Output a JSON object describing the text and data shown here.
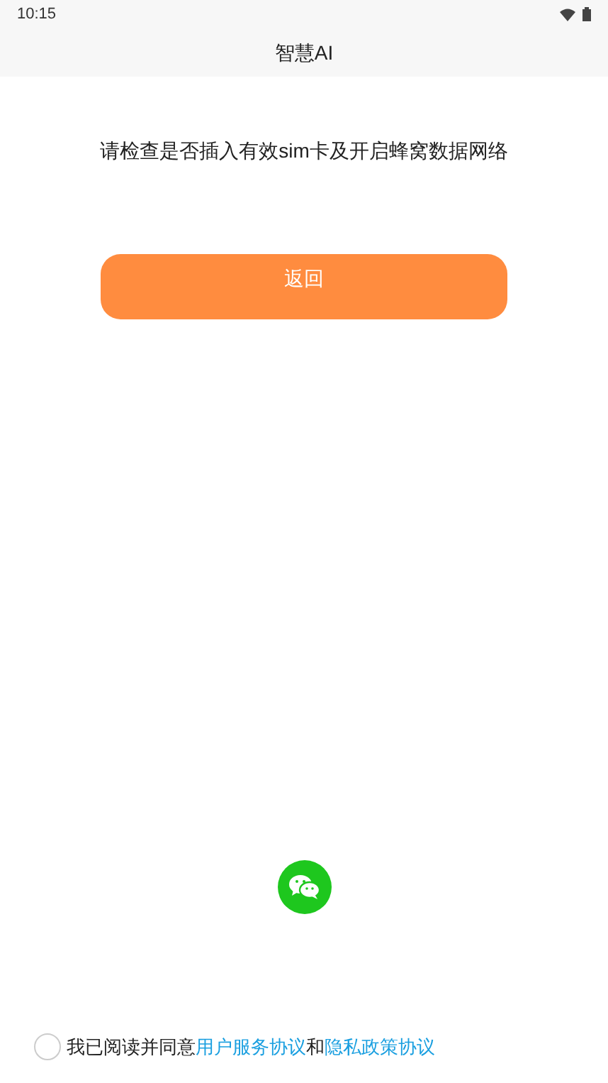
{
  "status_bar": {
    "time": "10:15"
  },
  "app_bar": {
    "title": "智慧AI"
  },
  "message": "请检查是否插入有效sim卡及开启蜂窝数据网络",
  "back_button": {
    "label": "返回"
  },
  "agreement": {
    "checked": false,
    "segments": [
      {
        "kind": "text",
        "text": "我已阅读并同意"
      },
      {
        "kind": "link",
        "text": "用户服务协议"
      },
      {
        "kind": "text",
        "text": "和"
      },
      {
        "kind": "link",
        "text": "隐私政策协议"
      }
    ]
  }
}
